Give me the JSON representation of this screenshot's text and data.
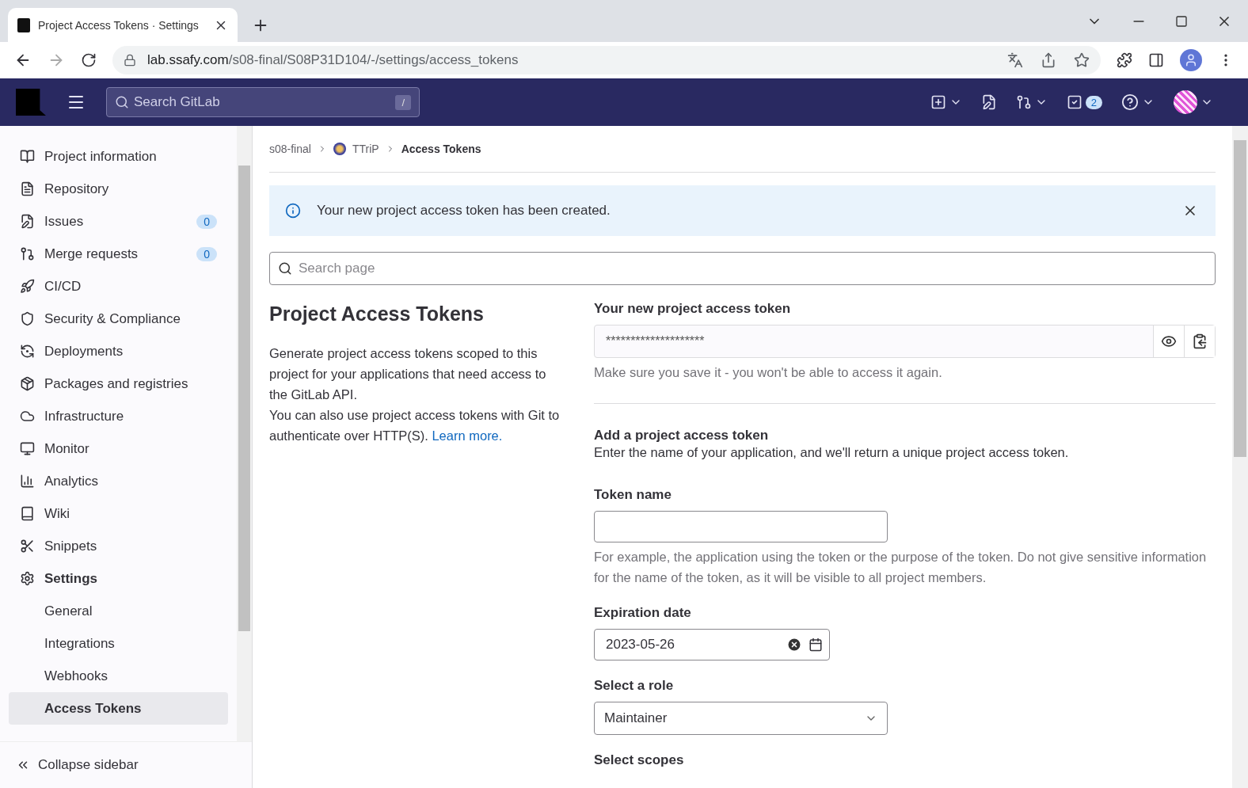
{
  "browser": {
    "tab_title": "Project Access Tokens · Settings",
    "url_host": "lab.ssafy.com",
    "url_path": "/s08-final/S08P31D104/-/settings/access_tokens"
  },
  "header": {
    "search_placeholder": "Search GitLab",
    "search_shortcut": "/",
    "todo_count": "2"
  },
  "sidebar": {
    "items": [
      {
        "label": "Project information",
        "selected": false
      },
      {
        "label": "Repository",
        "selected": false
      },
      {
        "label": "Issues",
        "badge": "0",
        "selected": false
      },
      {
        "label": "Merge requests",
        "badge": "0",
        "selected": false
      },
      {
        "label": "CI/CD",
        "selected": false
      },
      {
        "label": "Security & Compliance",
        "selected": false
      },
      {
        "label": "Deployments",
        "selected": false
      },
      {
        "label": "Packages and registries",
        "selected": false
      },
      {
        "label": "Infrastructure",
        "selected": false
      },
      {
        "label": "Monitor",
        "selected": false
      },
      {
        "label": "Analytics",
        "selected": false
      },
      {
        "label": "Wiki",
        "selected": false
      },
      {
        "label": "Snippets",
        "selected": false
      },
      {
        "label": "Settings",
        "selected": true,
        "children": [
          {
            "label": "General",
            "selected": false
          },
          {
            "label": "Integrations",
            "selected": false
          },
          {
            "label": "Webhooks",
            "selected": false
          },
          {
            "label": "Access Tokens",
            "selected": true
          }
        ]
      }
    ],
    "collapse": "Collapse sidebar"
  },
  "breadcrumbs": [
    {
      "label": "s08-final",
      "avatar": false,
      "current": false
    },
    {
      "label": "TTriP",
      "avatar": true,
      "current": false
    },
    {
      "label": "Access Tokens",
      "avatar": false,
      "current": true
    }
  ],
  "alert": {
    "message": "Your new project access token has been created."
  },
  "page_search": {
    "placeholder": "Search page"
  },
  "intro": {
    "title": "Project Access Tokens",
    "paragraphs": [
      "Generate project access tokens scoped to this project for your applications that need access to the GitLab API.",
      "You can also use project access tokens with Git to authenticate over HTTP(S)."
    ],
    "link": "Learn more."
  },
  "new_token": {
    "label": "Your new project access token",
    "value": "********************",
    "help": "Make sure you save it - you won't be able to access it again."
  },
  "form": {
    "title": "Add a project access token",
    "description": "Enter the name of your application, and we'll return a unique project access token.",
    "token_name": {
      "label": "Token name",
      "help": "For example, the application using the token or the purpose of the token. Do not give sensitive information for the name of the token, as it will be visible to all project members."
    },
    "expiration": {
      "label": "Expiration date",
      "value": "2023-05-26"
    },
    "role": {
      "label": "Select a role",
      "value": "Maintainer"
    },
    "scopes": {
      "label": "Select scopes"
    }
  }
}
